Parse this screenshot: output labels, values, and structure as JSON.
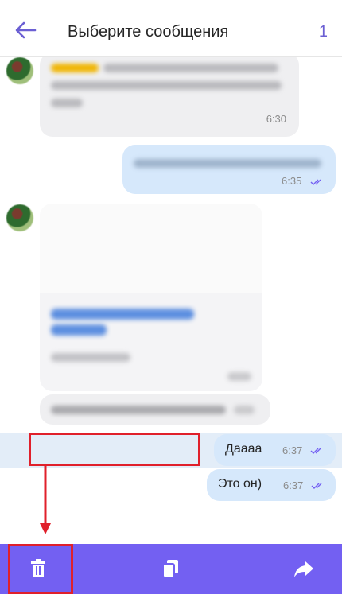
{
  "header": {
    "title": "Выберите сообщения",
    "selected_count": "1"
  },
  "messages": {
    "m1": {
      "time": "6:30"
    },
    "m2": {
      "time": "6:35"
    },
    "m5": {
      "text": "Даааа",
      "time": "6:37"
    },
    "m6": {
      "text": "Это он)",
      "time": "6:37"
    }
  },
  "colors": {
    "accent": "#7360f2",
    "outgoing_bubble": "#d6e8fb",
    "incoming_bubble": "#efeff1",
    "highlight": "#e0202b"
  },
  "toolbar": {
    "icons": [
      "trash-icon",
      "copy-icon",
      "forward-icon"
    ]
  }
}
